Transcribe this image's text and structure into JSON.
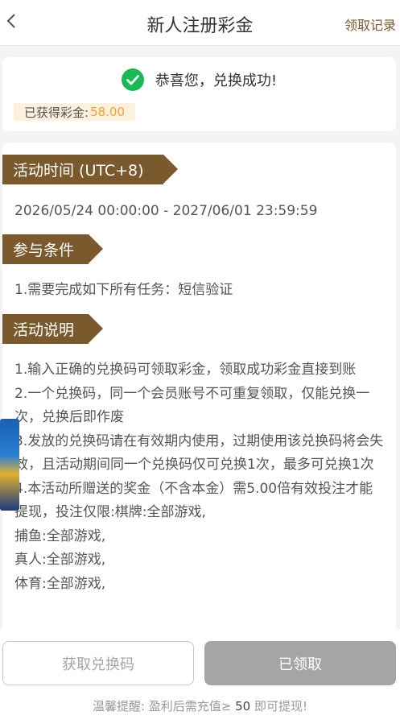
{
  "header": {
    "title": "新人注册彩金",
    "record_link": "领取记录"
  },
  "success": {
    "message": "恭喜您，兑换成功!",
    "bonus_label": "已获得彩金:",
    "bonus_value": "58.00",
    "accent_color": "#19b955"
  },
  "sections": {
    "time": {
      "title": "活动时间 (UTC+8)",
      "text": "2026/05/24 00:00:00 - 2027/06/01 23:59:59"
    },
    "condition": {
      "title": "参与条件",
      "text": "1.需要完成如下所有任务：短信验证"
    },
    "description": {
      "title": "活动说明",
      "items": [
        "1.输入正确的兑换码可领取彩金，领取成功彩金直接到账",
        "2.一个兑换码，同一个会员账号不可重复领取，仅能兑换一次，兑换后即作废",
        "3.发放的兑换码请在有效期内使用，过期使用该兑换码将会失效，且活动期间同一个兑换码仅可兑换1次，最多可兑换1次",
        "4.本活动所赠送的奖金（不含本金）需5.00倍有效投注才能提现，投注仅限:棋牌:全部游戏,",
        "捕鱼:全部游戏,",
        "真人:全部游戏,",
        "体育:全部游戏,"
      ]
    }
  },
  "buttons": {
    "get_code": "获取兑换码",
    "claimed": "已领取"
  },
  "tip": {
    "prefix": "温馨提醒: 盈利后需充值≥",
    "amount": "50",
    "suffix": "即可提现!"
  },
  "colors": {
    "brand": "#7a5a2c",
    "bonus": "#f2a231",
    "disabled": "#a5a5a5"
  }
}
